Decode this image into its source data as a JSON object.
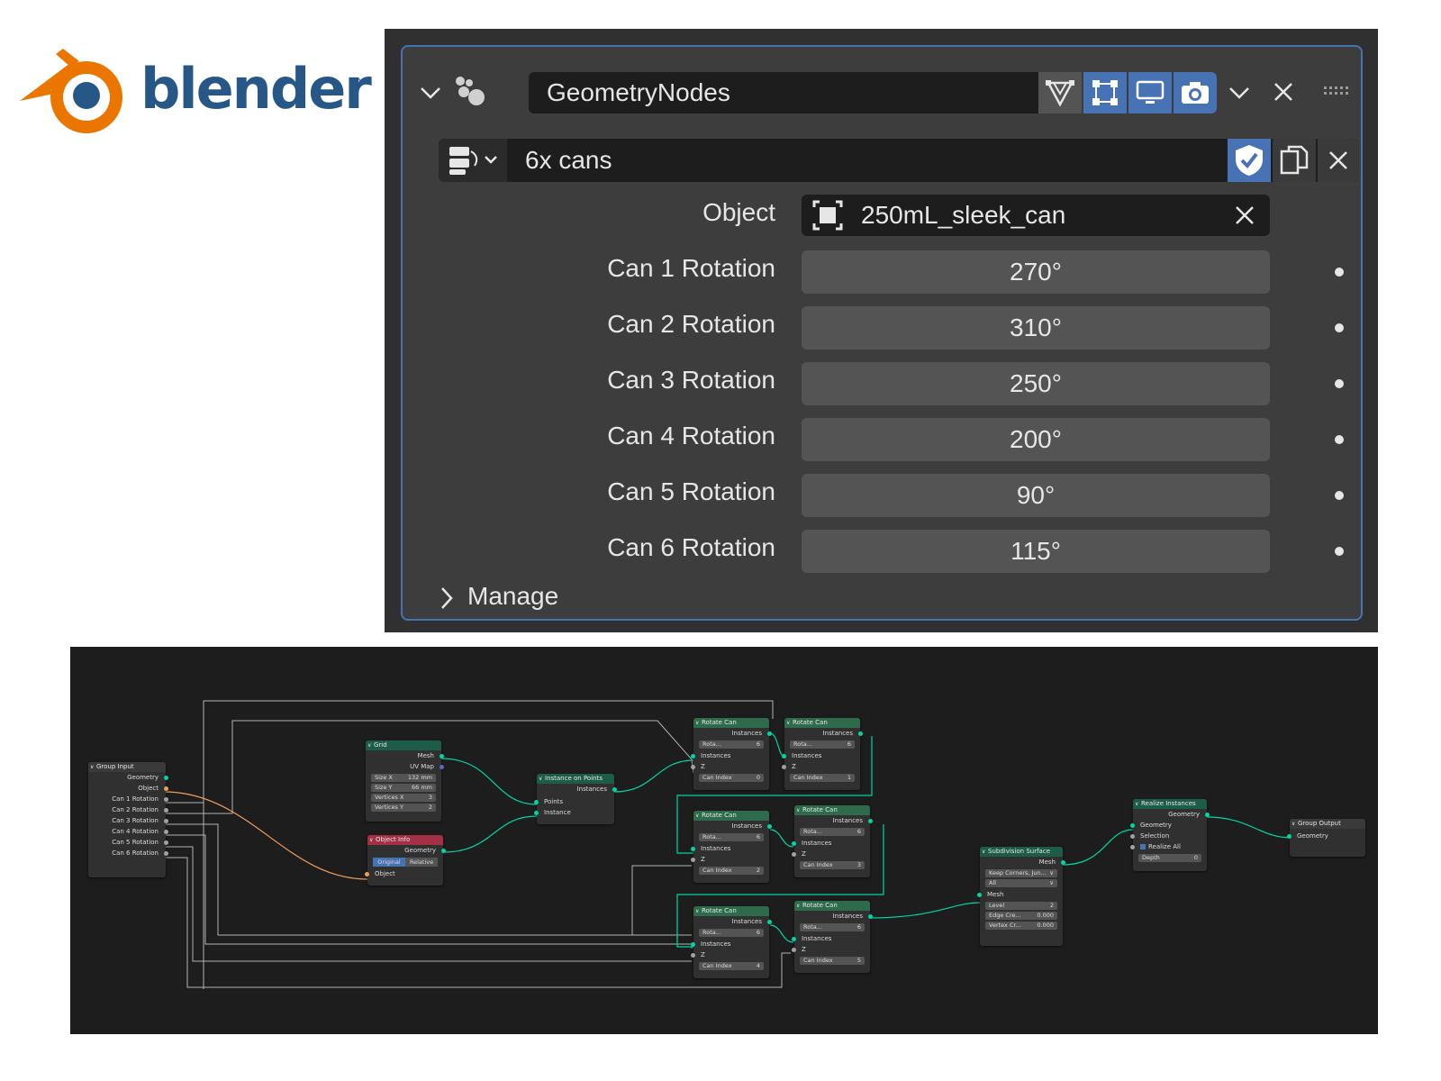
{
  "logo": {
    "text": "blender",
    "reg": "®"
  },
  "modifier": {
    "name": "GeometryNodes",
    "node_group": "6x cans",
    "object_label": "Object",
    "object_value": "250mL_sleek_can",
    "rotations": [
      {
        "label": "Can 1 Rotation",
        "value": "270°"
      },
      {
        "label": "Can 2 Rotation",
        "value": "310°"
      },
      {
        "label": "Can 3 Rotation",
        "value": "250°"
      },
      {
        "label": "Can 4 Rotation",
        "value": "200°"
      },
      {
        "label": "Can 5 Rotation",
        "value": "90°"
      },
      {
        "label": "Can 6 Rotation",
        "value": "115°"
      }
    ],
    "manage_label": "Manage",
    "accent": "#4772b3"
  },
  "nodes": {
    "group_input": {
      "title": "Group Input",
      "outputs": [
        "Geometry",
        "Object",
        "Can 1 Rotation",
        "Can 2 Rotation",
        "Can 3 Rotation",
        "Can 4 Rotation",
        "Can 5 Rotation",
        "Can 6 Rotation"
      ]
    },
    "grid": {
      "title": "Grid",
      "out_mesh": "Mesh",
      "out_uv": "UV Map",
      "fields": [
        {
          "label": "Size X",
          "value": "132 mm"
        },
        {
          "label": "Size Y",
          "value": "66 mm"
        },
        {
          "label": "Vertices X",
          "value": "3"
        },
        {
          "label": "Vertices Y",
          "value": "2"
        }
      ]
    },
    "object_info": {
      "title": "Object Info",
      "out_geometry": "Geometry",
      "opt_original": "Original",
      "opt_relative": "Relative",
      "in_object": "Object"
    },
    "instance_on_points": {
      "title": "Instance on Points",
      "out_instances": "Instances",
      "in_points": "Points",
      "in_instance": "Instance"
    },
    "rotate_can": {
      "title": "Rotate Can",
      "out_instances": "Instances",
      "rot_label": "Rota...",
      "rot_count": "6",
      "in_instances": "Instances",
      "in_z": "Z",
      "can_index_label": "Can Index",
      "indices": [
        "0",
        "1",
        "2",
        "3",
        "4",
        "5"
      ]
    },
    "subdivision": {
      "title": "Subdivision Surface",
      "out_mesh": "Mesh",
      "opt1": "Keep Corners, Jun...",
      "opt2": "All",
      "in_mesh": "Mesh",
      "fields": [
        {
          "label": "Level",
          "value": "2"
        },
        {
          "label": "Edge Cre...",
          "value": "0.000"
        },
        {
          "label": "Vertex Cr...",
          "value": "0.000"
        }
      ]
    },
    "realize": {
      "title": "Realize Instances",
      "out_geometry": "Geometry",
      "in_geometry": "Geometry",
      "in_selection": "Selection",
      "realize_all": "Realize All",
      "depth_label": "Depth",
      "depth_value": "0"
    },
    "group_output": {
      "title": "Group Output",
      "in_geometry": "Geometry"
    }
  }
}
